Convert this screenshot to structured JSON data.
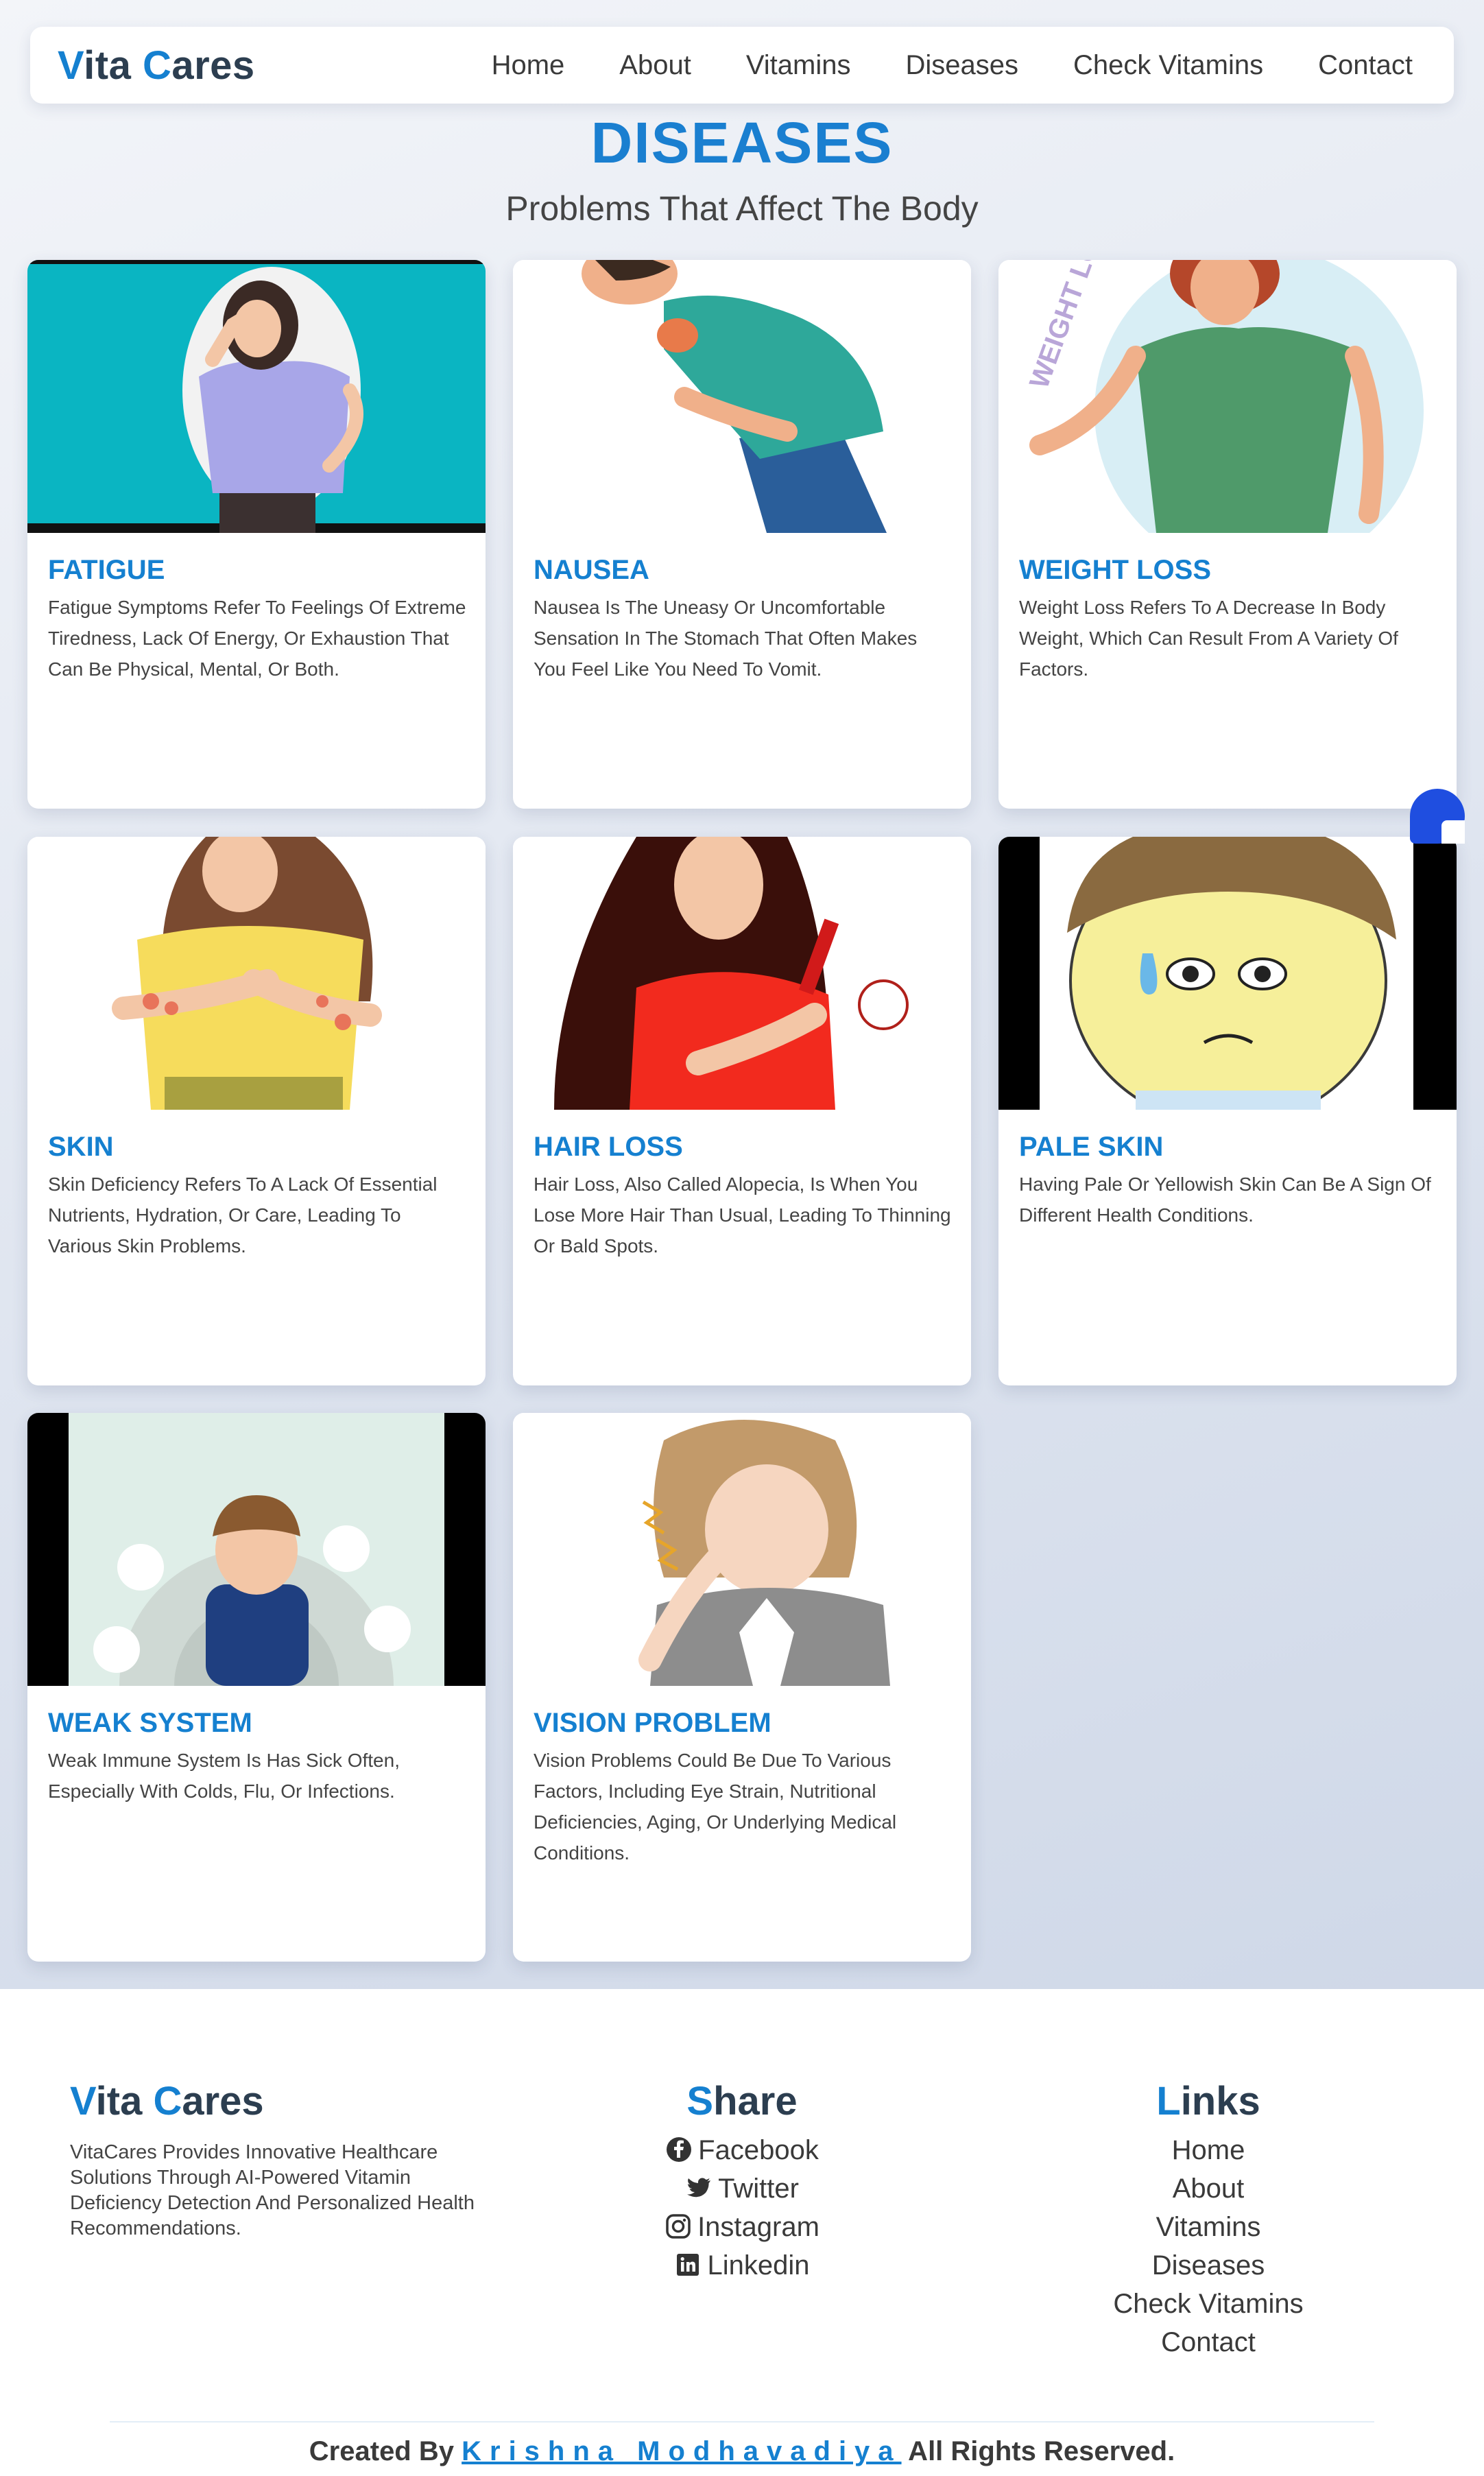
{
  "nav": {
    "brand_first": "V",
    "brand_mid": "ita ",
    "brand_c": "C",
    "brand_rest": "ares",
    "links": [
      "Home",
      "About",
      "Vitamins",
      "Diseases",
      "Check Vitamins",
      "Contact"
    ]
  },
  "header": {
    "title": "DISEASES",
    "subtitle": "Problems That Affect The Body"
  },
  "cards": [
    {
      "title": "FATIGUE",
      "text": "Fatigue Symptoms Refer To Feelings Of Extreme Tiredness, Lack Of Energy, Or Exhaustion That Can Be Physical, Mental, Or Both.",
      "image_icon": "woman-headache-illustration"
    },
    {
      "title": "NAUSEA",
      "text": "Nausea Is The Uneasy Or Uncomfortable Sensation In The Stomach That Often Makes You Feel Like You Need To Vomit.",
      "image_icon": "man-nauseous-illustration"
    },
    {
      "title": "WEIGHT LOSS",
      "text": "Weight Loss Refers To A Decrease In Body Weight, Which Can Result From A Variety Of Factors.",
      "image_icon": "man-loose-pants-illustration",
      "image_text": "WEIGHT LOSS"
    },
    {
      "title": "SKIN",
      "text": "Skin Deficiency Refers To A Lack Of Essential Nutrients, Hydration, Or Care, Leading To Various Skin Problems.",
      "image_icon": "woman-itchy-skin-illustration"
    },
    {
      "title": "HAIR LOSS",
      "text": "Hair Loss, Also Called Alopecia, Is When You Lose More Hair Than Usual, Leading To Thinning Or Bald Spots.",
      "image_icon": "woman-hair-comb-illustration"
    },
    {
      "title": "PALE SKIN",
      "text": "Having Pale Or Yellowish Skin Can Be A Sign Of Different Health Conditions.",
      "image_icon": "pale-boy-face-illustration"
    },
    {
      "title": "WEAK SYSTEM",
      "text": "Weak Immune System Is Has Sick Often, Especially With Colds, Flu, Or Infections.",
      "image_icon": "sick-boy-illustration"
    },
    {
      "title": "VISION PROBLEM",
      "text": "Vision Problems Could Be Due To Various Factors, Including Eye Strain, Nutritional Deficiencies, Aging, Or Underlying Medical Conditions.",
      "image_icon": "woman-eye-strain-illustration"
    }
  ],
  "footer": {
    "brand_v": "V",
    "brand_mid": "ita ",
    "brand_c": "C",
    "brand_rest": "ares",
    "about": "VitaCares Provides Innovative Healthcare Solutions Through AI-Powered Vitamin Deficiency Detection And Personalized Health Recommendations.",
    "share_first": "S",
    "share_rest": "hare",
    "share_links": [
      {
        "label": "Facebook",
        "icon": "facebook-icon"
      },
      {
        "label": "Twitter",
        "icon": "twitter-icon"
      },
      {
        "label": "Instagram",
        "icon": "instagram-icon"
      },
      {
        "label": "Linkedin",
        "icon": "linkedin-icon"
      }
    ],
    "links_first": "L",
    "links_rest": "inks",
    "links": [
      "Home",
      "About",
      "Vitamins",
      "Diseases",
      "Check Vitamins",
      "Contact"
    ],
    "copyright_pre": "Created By ",
    "author": "Krishna Modhavadiya",
    "copyright_post": " All Rights Reserved."
  },
  "colors": {
    "accent": "#1580d0",
    "dark": "#2c3e50",
    "chat": "#1f4ee0"
  }
}
